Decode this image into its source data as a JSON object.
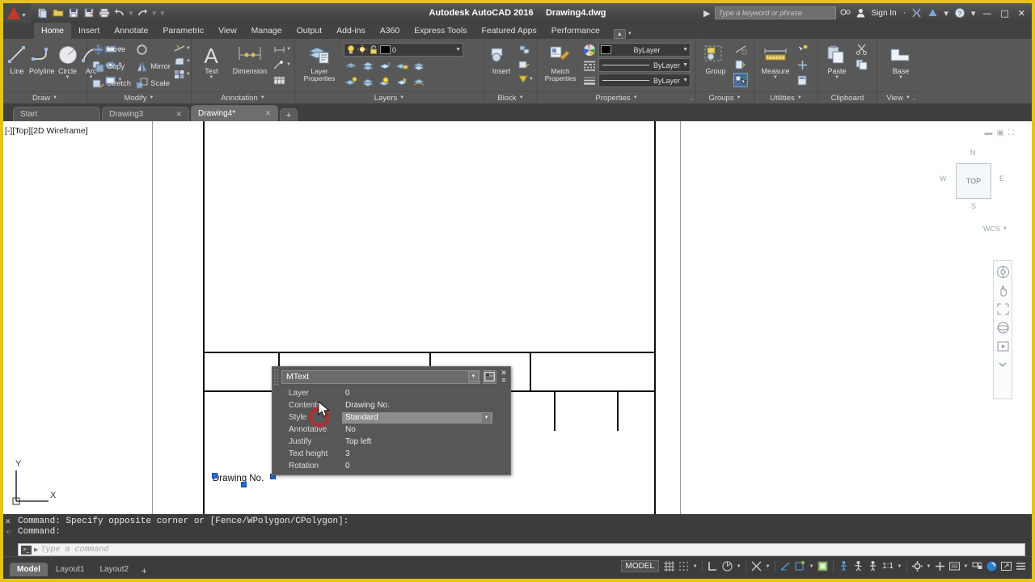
{
  "titlebar": {
    "app_name": "Autodesk AutoCAD 2016",
    "document": "Drawing4.dwg",
    "search_placeholder": "Type a keyword or phrase",
    "sign_in": "Sign In",
    "quick_access": [
      {
        "name": "new-icon",
        "glyph": "⬚"
      },
      {
        "name": "open-icon",
        "glyph": "▱"
      },
      {
        "name": "save-icon",
        "glyph": "▤"
      },
      {
        "name": "save-as-icon",
        "glyph": "▥"
      },
      {
        "name": "plot-icon",
        "glyph": "⎙"
      },
      {
        "name": "undo-icon",
        "glyph": "↶"
      },
      {
        "name": "redo-icon",
        "glyph": "↷"
      }
    ],
    "window_controls": {
      "minimize": "—",
      "maximize": "□",
      "close": "✕"
    }
  },
  "ribbon": {
    "tabs": [
      {
        "label": "Home",
        "active": true
      },
      {
        "label": "Insert",
        "active": false
      },
      {
        "label": "Annotate",
        "active": false
      },
      {
        "label": "Parametric",
        "active": false
      },
      {
        "label": "View",
        "active": false
      },
      {
        "label": "Manage",
        "active": false
      },
      {
        "label": "Output",
        "active": false
      },
      {
        "label": "Add-ins",
        "active": false
      },
      {
        "label": "A360",
        "active": false
      },
      {
        "label": "Express Tools",
        "active": false
      },
      {
        "label": "Featured Apps",
        "active": false
      },
      {
        "label": "Performance",
        "active": false
      }
    ],
    "panels": {
      "draw": {
        "label": "Draw",
        "tools": [
          "Line",
          "Polyline",
          "Circle",
          "Arc"
        ]
      },
      "modify": {
        "label": "Modify",
        "tools": [
          "Move",
          "Copy",
          "Stretch",
          "Rotate",
          "Mirror",
          "Scale"
        ]
      },
      "annotation": {
        "label": "Annotation",
        "tools": [
          "Text",
          "Dimension"
        ]
      },
      "layers": {
        "label": "Layers",
        "layer_properties": "Layer\nProperties",
        "current_layer": "0"
      },
      "block": {
        "label": "Block",
        "tools": [
          "Insert"
        ]
      },
      "properties": {
        "label": "Properties",
        "match": "Match\nProperties",
        "color": "ByLayer",
        "linetype": "ByLayer",
        "lineweight": "ByLayer"
      },
      "groups": {
        "label": "Groups",
        "tools": [
          "Group"
        ]
      },
      "utilities": {
        "label": "Utilities",
        "tools": [
          "Measure"
        ]
      },
      "clipboard": {
        "label": "Clipboard",
        "tools": [
          "Paste"
        ]
      },
      "view": {
        "label": "View",
        "tools": [
          "Base"
        ]
      }
    }
  },
  "file_tabs": [
    {
      "label": "Start",
      "closable": false,
      "active": false
    },
    {
      "label": "Drawing3",
      "closable": true,
      "active": false
    },
    {
      "label": "Drawing4*",
      "closable": true,
      "active": true
    }
  ],
  "canvas": {
    "viewport_label": "[-][Top][2D Wireframe]",
    "selected_text": "Drawing No.",
    "viewcube": {
      "face": "TOP",
      "north": "N",
      "south": "S",
      "west": "W",
      "east": "E",
      "ucs": "WCS"
    },
    "ucs_axes": {
      "x": "X",
      "y": "Y"
    }
  },
  "quick_properties": {
    "title": "MText",
    "rows": [
      {
        "key": "Layer",
        "value": "0",
        "editable": false
      },
      {
        "key": "Contents",
        "value": "Drawing No.",
        "editable": false
      },
      {
        "key": "Style",
        "value": "Standard",
        "editable": true
      },
      {
        "key": "Annotative",
        "value": "No",
        "editable": false
      },
      {
        "key": "Justify",
        "value": "Top left",
        "editable": false
      },
      {
        "key": "Text height",
        "value": "3",
        "editable": false
      },
      {
        "key": "Rotation",
        "value": "0",
        "editable": false
      }
    ],
    "close_label": "✕",
    "options_label": "≡"
  },
  "command_line": {
    "history_line_1": "Command: Specify opposite corner or [Fence/WPolygon/CPolygon]:",
    "history_line_2": "Command:",
    "input_placeholder": "Type a command"
  },
  "status_bar": {
    "layout_tabs": [
      {
        "label": "Model",
        "active": true
      },
      {
        "label": "Layout1",
        "active": false
      },
      {
        "label": "Layout2",
        "active": false
      }
    ],
    "add_layout": "+",
    "space_toggle": "MODEL",
    "annotation_scale": "1:1",
    "icons": [
      {
        "name": "grid-display-icon",
        "glyph": "⌗"
      },
      {
        "name": "snap-mode-icon",
        "glyph": "░"
      },
      {
        "name": "ortho-mode-icon",
        "glyph": "┗"
      },
      {
        "name": "polar-tracking-icon",
        "glyph": "◔"
      },
      {
        "name": "object-snap-icon",
        "glyph": "∠"
      },
      {
        "name": "osnap-tracking-icon",
        "glyph": "◢"
      },
      {
        "name": "ucs-icon",
        "glyph": "◱"
      },
      {
        "name": "isolate-objects-icon",
        "glyph": "▦"
      },
      {
        "name": "annotation-visibility-icon",
        "glyph": "Ὣ6"
      },
      {
        "name": "autoscale-icon",
        "glyph": "ઃ"
      },
      {
        "name": "annotation-scale-icon",
        "glyph": "⚘"
      },
      {
        "name": "workspace-switching-icon",
        "glyph": "⚙"
      },
      {
        "name": "hardware-acceleration-icon",
        "glyph": "✚"
      },
      {
        "name": "isolate-display-icon",
        "glyph": "▣"
      },
      {
        "name": "clean-screen-icon",
        "glyph": "❐"
      },
      {
        "name": "customization-icon",
        "glyph": "☰"
      }
    ]
  }
}
